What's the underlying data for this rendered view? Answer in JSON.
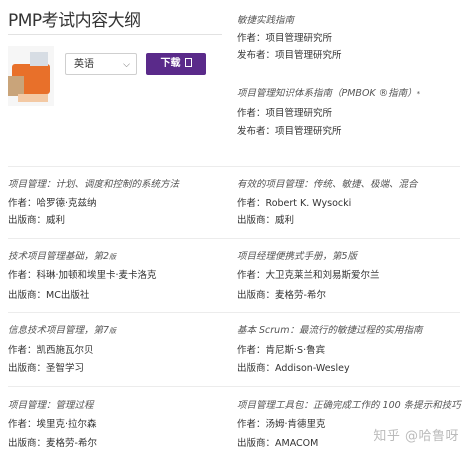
{
  "page": {
    "title": "PMP考试内容大纲"
  },
  "download": {
    "language_value": "英语",
    "button_label": "下载"
  },
  "books": [
    {
      "title": "敏捷实践指南",
      "sup": "",
      "author_label": "作者：",
      "author": "项目管理研究所",
      "publisher_label": "发布者：",
      "publisher": "项目管理研究所"
    },
    {
      "title": "项目管理知识体系指南（PMBOK ®指南）",
      "sup": "*",
      "author_label": "作者：",
      "author": "项目管理研究所",
      "publisher_label": "发布者：",
      "publisher": "项目管理研究所"
    },
    {
      "title": "项目管理：计划、调度和控制的系统方法",
      "sup": "",
      "author_label": "作者：",
      "author": "哈罗德·克兹纳",
      "publisher_label": "出版商：",
      "publisher": "威利"
    },
    {
      "title": "有效的项目管理：传统、敏捷、极端、混合",
      "sup": "",
      "author_label": "作者：",
      "author": "Robert K. Wysocki",
      "publisher_label": "出版商：",
      "publisher": "威利"
    },
    {
      "title": "技术项目管理基础，第2",
      "sup": "版",
      "author_label": "作者：",
      "author": "科琳·加顿和埃里卡·麦卡洛克",
      "publisher_label": "出版商：",
      "publisher": "MC出版社"
    },
    {
      "title": "项目经理便携式手册，第5版",
      "sup": "",
      "author_label": "作者：",
      "author": "大卫克莱兰和刘易斯爱尔兰",
      "publisher_label": "出版商：",
      "publisher": "麦格劳-希尔"
    },
    {
      "title": "信息技术项目管理，第7",
      "sup": "版",
      "author_label": "作者：",
      "author": "凯西施瓦尔贝",
      "publisher_label": "出版商：",
      "publisher": "圣智学习"
    },
    {
      "title": "基本 Scrum：最流行的敏捷过程的实用指南",
      "sup": "",
      "author_label": "作者：",
      "author": "肯尼斯·S·鲁宾",
      "publisher_label": "出版商：",
      "publisher": "Addison-Wesley"
    },
    {
      "title": "项目管理：管理过程",
      "sup": "",
      "author_label": "作者：",
      "author": "埃里克·拉尔森",
      "publisher_label": "出版商：",
      "publisher": "麦格劳-希尔"
    },
    {
      "title": "项目管理工具包：正确完成工作的 100 条提示和技巧",
      "sup": "",
      "author_label": "作者：",
      "author": "汤姆·肯德里克",
      "publisher_label": "出版商：",
      "publisher": "AMACOM"
    }
  ],
  "watermark": "知乎 @哈鲁呀",
  "colors": {
    "button": "#5a2a8a",
    "accent_cover": "#e8702a"
  },
  "icons": {
    "select_arrow": "chevron-down-icon",
    "download": "document-icon"
  }
}
